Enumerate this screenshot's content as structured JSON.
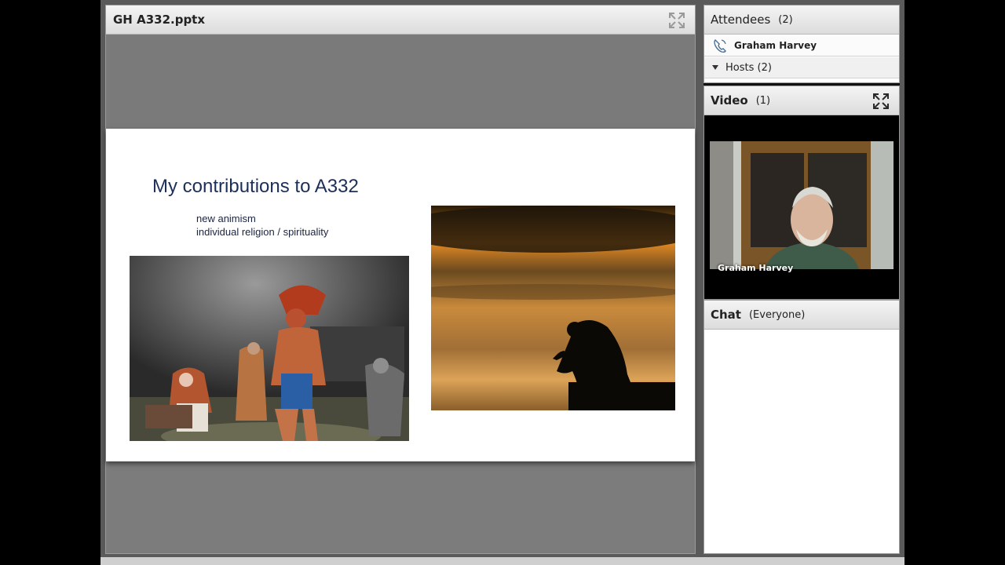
{
  "share_pod": {
    "title": "GH A332.pptx",
    "fullscreen_icon": "fullscreen-icon"
  },
  "slide": {
    "title": "My contributions to A332",
    "bullets": [
      "new animism",
      "individual religion / spirituality"
    ]
  },
  "attendees": {
    "title": "Attendees",
    "count": "(2)",
    "items": [
      {
        "name": "Graham Harvey",
        "icon": "phone-icon"
      }
    ],
    "hosts_label": "Hosts (2)"
  },
  "video": {
    "title": "Video",
    "count": "(1)",
    "speaker_name": "Graham Harvey"
  },
  "chat": {
    "title": "Chat",
    "scope": "(Everyone)"
  },
  "colors": {
    "header_bg": "#e6e6e6",
    "slide_title": "#1c2f59",
    "share_bg": "#7c7c7c"
  }
}
